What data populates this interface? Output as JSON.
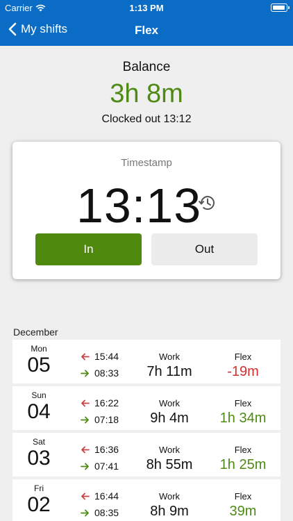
{
  "status": {
    "carrier": "Carrier",
    "time": "1:13 PM"
  },
  "nav": {
    "back_label": "My shifts",
    "title": "Flex"
  },
  "balance": {
    "label": "Balance",
    "value": "3h 8m",
    "clocked": "Clocked  out  13:12"
  },
  "timestamp": {
    "label": "Timestamp",
    "time": "13:13",
    "in_label": "In",
    "out_label": "Out"
  },
  "section_label": "December",
  "colors": {
    "brand": "#0a6cc4",
    "in_button": "#4f8a0f",
    "positive": "#4e8a14",
    "negative": "#d03030"
  },
  "shifts": [
    {
      "dow": "Mon",
      "day": "05",
      "out": "15:44",
      "in": "08:33",
      "work_label": "Work",
      "work": "7h 11m",
      "flex_label": "Flex",
      "flex": "-19m"
    },
    {
      "dow": "Sun",
      "day": "04",
      "out": "16:22",
      "in": "07:18",
      "work_label": "Work",
      "work": "9h 4m",
      "flex_label": "Flex",
      "flex": "1h 34m"
    },
    {
      "dow": "Sat",
      "day": "03",
      "out": "16:36",
      "in": "07:41",
      "work_label": "Work",
      "work": "8h 55m",
      "flex_label": "Flex",
      "flex": "1h 25m"
    },
    {
      "dow": "Fri",
      "day": "02",
      "out": "16:44",
      "in": "08:35",
      "work_label": "Work",
      "work": "8h 9m",
      "flex_label": "Flex",
      "flex": "39m"
    }
  ]
}
